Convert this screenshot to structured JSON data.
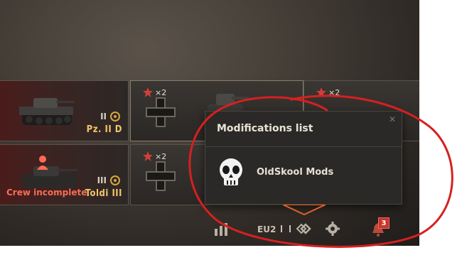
{
  "tanks": [
    {
      "name": "Pz. II D",
      "tier": "II",
      "status": ""
    },
    {
      "name": "",
      "tier": "",
      "xp_multiplier": "×2"
    },
    {
      "name": "",
      "tier": "",
      "xp_multiplier": "×2"
    },
    {
      "name": "Toldi III",
      "tier": "III",
      "status": "Crew incomplete"
    },
    {
      "name": "",
      "tier": "",
      "xp_multiplier": "×2"
    }
  ],
  "popup": {
    "title": "Modifications list",
    "close": "✕",
    "mods": [
      {
        "name": "OldSkool Mods",
        "icon": "skull-icon"
      }
    ]
  },
  "bottom_bar": {
    "server": "EU2",
    "notifications_count": "3"
  },
  "colors": {
    "annotation": "#d62020",
    "tank_name": "#f2c66a",
    "warning": "#ff6a55"
  }
}
